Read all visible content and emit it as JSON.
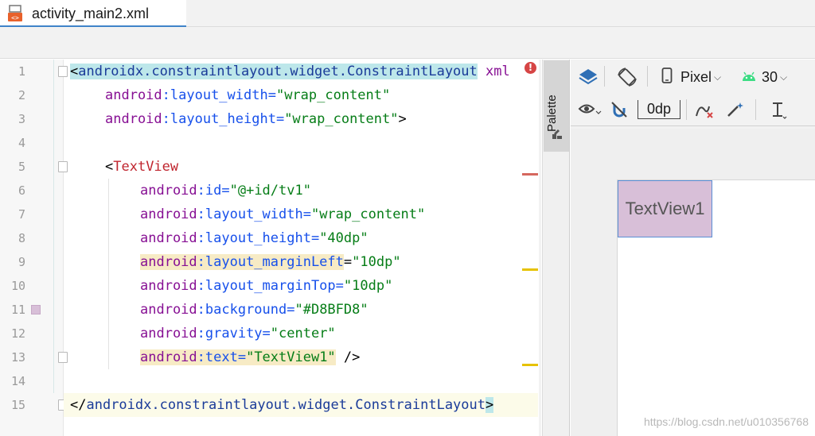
{
  "tab": {
    "title": "activity_main2.xml",
    "icon": "xml-file-icon"
  },
  "editor": {
    "line_numbers": [
      "1",
      "2",
      "3",
      "4",
      "5",
      "6",
      "7",
      "8",
      "9",
      "10",
      "11",
      "12",
      "13",
      "14",
      "15"
    ],
    "lines": [
      {
        "parts": [
          "<",
          "androidx.constraintlayout.widget.ConstraintLayout",
          " xml"
        ]
      },
      {
        "parts": [
          "android",
          ":layout_width=",
          "\"wrap_content\""
        ]
      },
      {
        "parts": [
          "android",
          ":layout_height=",
          "\"wrap_content\"",
          ">"
        ]
      },
      {
        "parts": []
      },
      {
        "parts": [
          "<",
          "TextView"
        ]
      },
      {
        "parts": [
          "android",
          ":id=",
          "\"@+id/tv1\""
        ]
      },
      {
        "parts": [
          "android",
          ":layout_width=",
          "\"wrap_content\""
        ]
      },
      {
        "parts": [
          "android",
          ":layout_height=",
          "\"40dp\""
        ]
      },
      {
        "parts": [
          "android",
          ":layout_marginLeft",
          "=",
          "\"10dp\""
        ]
      },
      {
        "parts": [
          "android",
          ":layout_marginTop=",
          "\"10dp\""
        ]
      },
      {
        "parts": [
          "android",
          ":background=",
          "\"#D8BFD8\""
        ]
      },
      {
        "parts": [
          "android",
          ":gravity=",
          "\"center\""
        ]
      },
      {
        "parts": [
          "android",
          ":text=",
          "\"TextView1\"",
          " />"
        ]
      },
      {
        "parts": []
      },
      {
        "parts": [
          "</",
          "androidx.constraintlayout.widget.ConstraintLayout",
          ">"
        ]
      }
    ],
    "error_badge": "!",
    "swatch_color": "#D8BFD8"
  },
  "palette": {
    "label": "Palette"
  },
  "design_toolbar": {
    "device": "Pixel",
    "api": "30",
    "margin": "0dp",
    "icons": [
      "layers-icon",
      "orientation-icon",
      "phone-icon",
      "android-icon",
      "eye-icon",
      "magnet-off-icon",
      "clear-constraints-icon",
      "magic-wand-icon",
      "align-icon"
    ]
  },
  "preview": {
    "text": "TextView1",
    "background": "#D8BFD8"
  },
  "watermark": "https://blog.csdn.net/u010356768"
}
